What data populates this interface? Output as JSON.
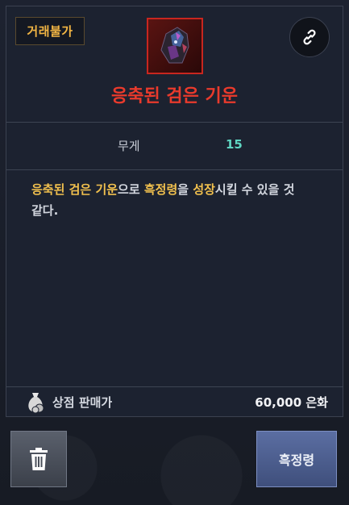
{
  "badge": {
    "label": "거래불가"
  },
  "item": {
    "name": "응축된 검은 기운",
    "icon": "dark-crystal-item-icon",
    "rarity_color": "#e93a2c"
  },
  "stats": [
    {
      "label": "무게",
      "value": "15"
    }
  ],
  "description": {
    "part1": "응축된 검은 기운",
    "part2": "으로 ",
    "part3": "흑정령",
    "part4": "을 ",
    "part5": "성장",
    "part6": "시킬 수 있을 것 같다."
  },
  "price": {
    "label": "상점 판매가",
    "value": "60,000 은화",
    "icon": "money-bag-icon"
  },
  "buttons": {
    "delete_icon": "trash-icon",
    "action_label": "흑정령"
  },
  "link_icon": "link-icon"
}
